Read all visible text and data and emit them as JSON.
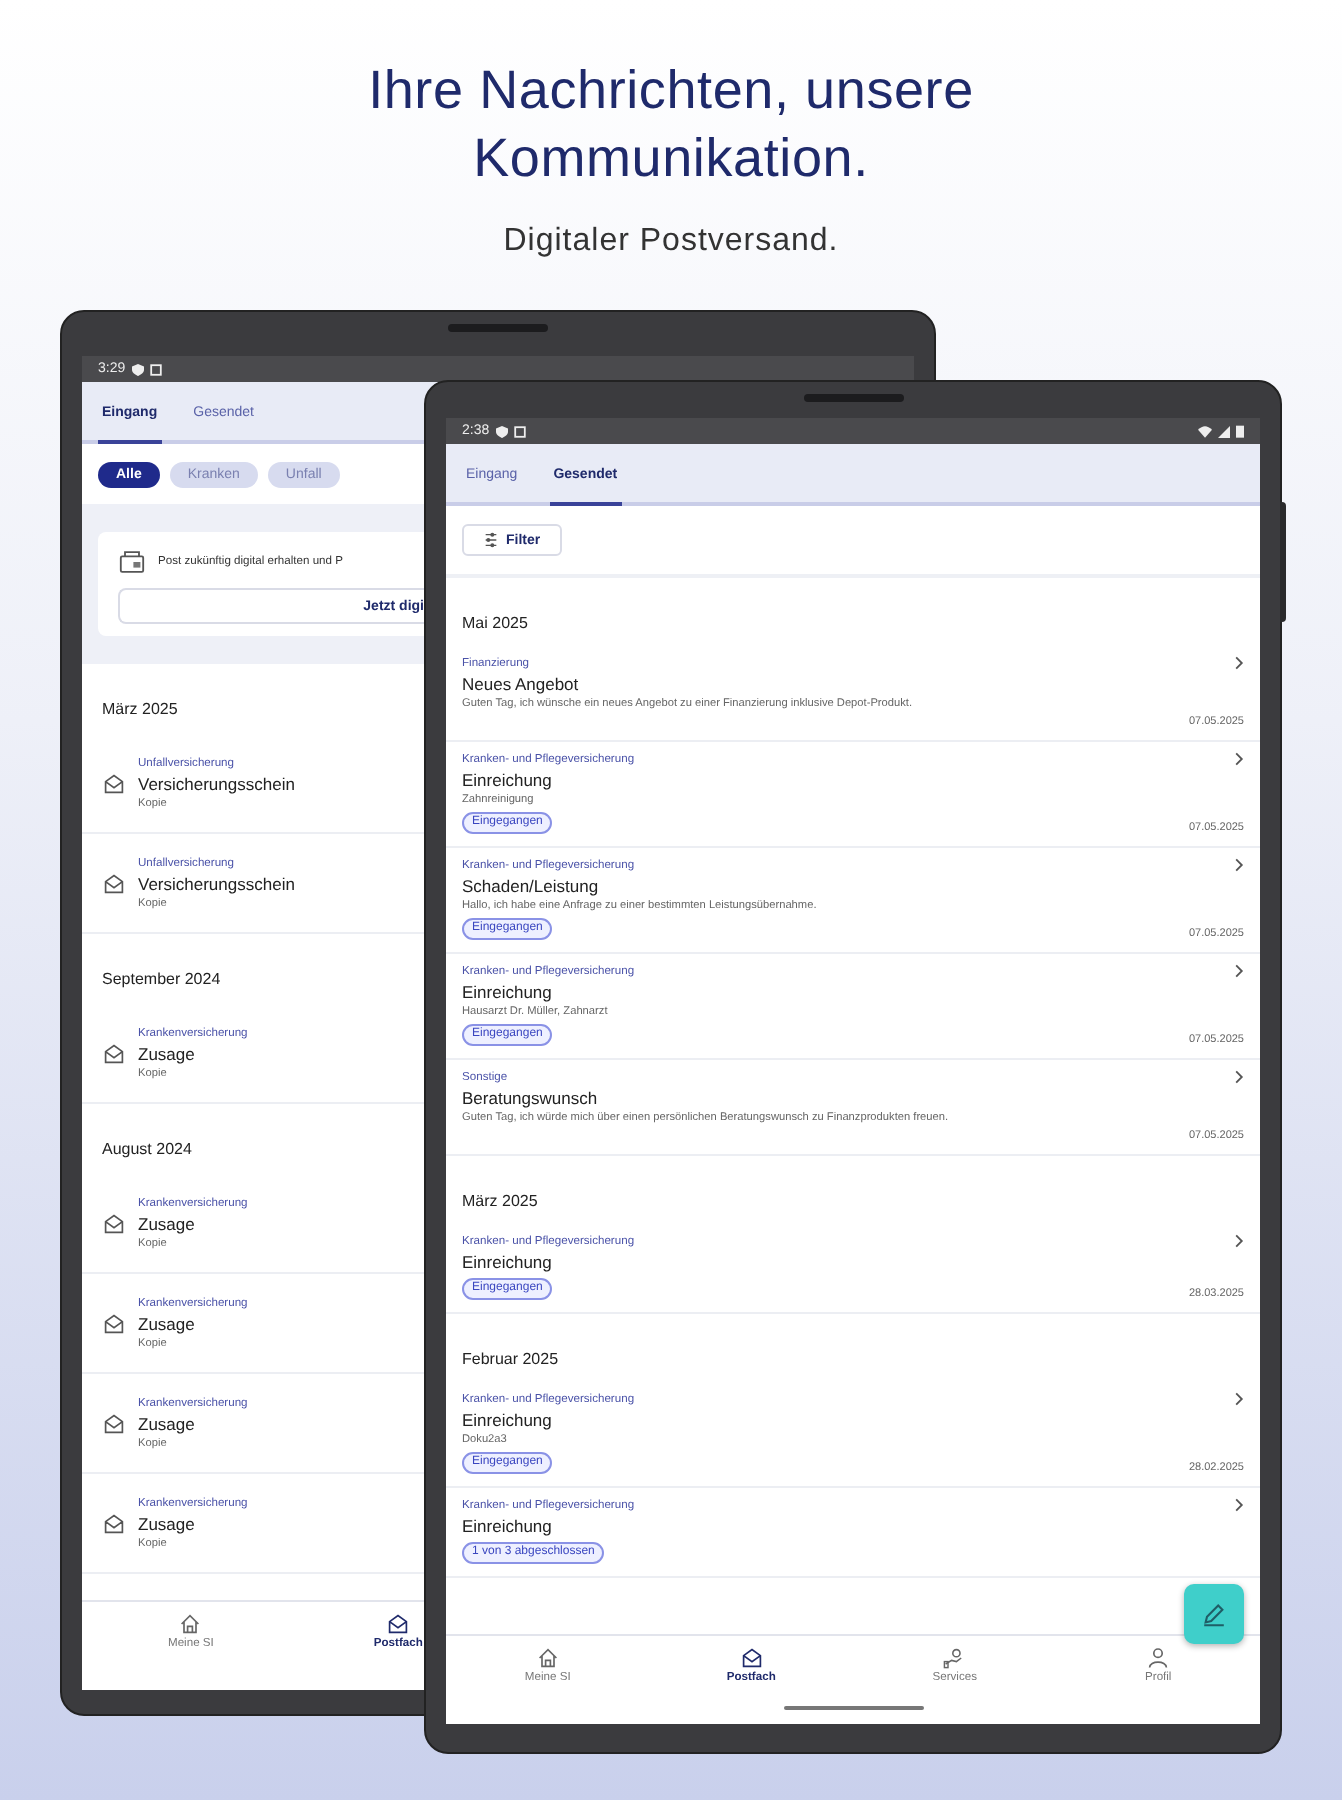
{
  "headline": "Ihre Nachrichten, unsere Kommunikation.",
  "subline": "Digitaler Postversand.",
  "back_tablet": {
    "status_time": "3:29",
    "tabs": [
      {
        "label": "Eingang",
        "selected": true
      },
      {
        "label": "Gesendet",
        "selected": false
      }
    ],
    "chips": [
      {
        "label": "Alle",
        "selected": true
      },
      {
        "label": "Kranken",
        "selected": false
      },
      {
        "label": "Unfall",
        "selected": false
      }
    ],
    "banner": {
      "text": "Post zukünftig digital erhalten und P",
      "button": "Jetzt digi"
    },
    "sections": [
      {
        "heading": "März 2025",
        "messages": [
          {
            "category": "Unfallversicherung",
            "title": "Versicherungsschein",
            "note": "Kopie"
          },
          {
            "category": "Unfallversicherung",
            "title": "Versicherungsschein",
            "note": "Kopie"
          }
        ]
      },
      {
        "heading": "September 2024",
        "messages": [
          {
            "category": "Krankenversicherung",
            "title": "Zusage",
            "note": "Kopie"
          }
        ]
      },
      {
        "heading": "August 2024",
        "messages": [
          {
            "category": "Krankenversicherung",
            "title": "Zusage",
            "note": "Kopie"
          },
          {
            "category": "Krankenversicherung",
            "title": "Zusage",
            "note": "Kopie"
          },
          {
            "category": "Krankenversicherung",
            "title": "Zusage",
            "note": "Kopie"
          },
          {
            "category": "Krankenversicherung",
            "title": "Zusage",
            "note": "Kopie"
          }
        ]
      }
    ],
    "nav": [
      {
        "label": "Meine SI",
        "selected": false
      },
      {
        "label": "Postfach",
        "selected": true
      }
    ]
  },
  "front_tablet": {
    "status_time": "2:38",
    "tabs": [
      {
        "label": "Eingang",
        "selected": false
      },
      {
        "label": "Gesendet",
        "selected": true
      }
    ],
    "filter_button": "Filter",
    "sections": [
      {
        "heading": "Mai 2025",
        "messages": [
          {
            "category": "Finanzierung",
            "title": "Neues Angebot",
            "note": "Guten Tag, ich wünsche ein neues Angebot zu einer Finanzierung inklusive Depot-Produkt.",
            "date": "07.05.2025"
          },
          {
            "category": "Kranken- und Pflegeversicherung",
            "title": "Einreichung",
            "note": "Zahnreinigung",
            "badge": "Eingegangen",
            "date": "07.05.2025"
          },
          {
            "category": "Kranken- und Pflegeversicherung",
            "title": "Schaden/Leistung",
            "note": "Hallo, ich habe eine Anfrage zu einer bestimmten Leistungsübernahme.",
            "badge": "Eingegangen",
            "date": "07.05.2025"
          },
          {
            "category": "Kranken- und Pflegeversicherung",
            "title": "Einreichung",
            "note": "Hausarzt Dr. Müller, Zahnarzt",
            "badge": "Eingegangen",
            "date": "07.05.2025"
          },
          {
            "category": "Sonstige",
            "title": "Beratungswunsch",
            "note": "Guten Tag, ich würde mich über einen persönlichen Beratungswunsch zu Finanzprodukten freuen.",
            "date": "07.05.2025"
          }
        ]
      },
      {
        "heading": "März 2025",
        "messages": [
          {
            "category": "Kranken- und Pflegeversicherung",
            "title": "Einreichung",
            "badge": "Eingegangen",
            "date": "28.03.2025"
          }
        ]
      },
      {
        "heading": "Februar 2025",
        "messages": [
          {
            "category": "Kranken- und Pflegeversicherung",
            "title": "Einreichung",
            "note": "Doku2a3",
            "badge": "Eingegangen",
            "date": "28.02.2025"
          },
          {
            "category": "Kranken- und Pflegeversicherung",
            "title": "Einreichung",
            "badge": "1 von 3 abgeschlossen"
          }
        ]
      }
    ],
    "nav": [
      {
        "label": "Meine SI",
        "selected": false
      },
      {
        "label": "Postfach",
        "selected": true
      },
      {
        "label": "Services",
        "selected": false
      },
      {
        "label": "Profil",
        "selected": false
      }
    ]
  }
}
